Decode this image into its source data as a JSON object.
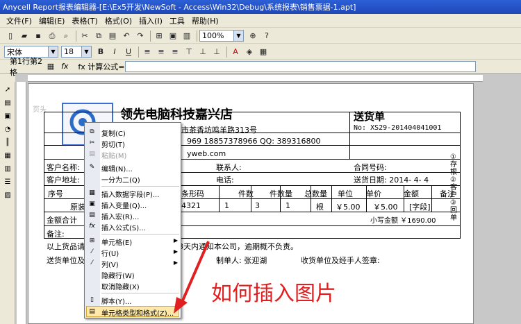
{
  "window": {
    "title": "Anycell Report报表编辑器-[E:\\Ex5开发\\NewSoft - Access\\Win32\\Debug\\系统报表\\销售票据-1.apt]"
  },
  "menu": [
    "文件(F)",
    "编辑(E)",
    "表格(T)",
    "格式(O)",
    "插入(I)",
    "工具",
    "帮助(H)"
  ],
  "toolbar": {
    "zoom": "100%"
  },
  "format": {
    "font": "宋体",
    "size": "18"
  },
  "formula": {
    "cell_ref": "第1行第2格",
    "fx_label": "fx",
    "calc_label": "fx 计算公式="
  },
  "report": {
    "watermark": "页头",
    "company": "领先电脑科技嘉兴店",
    "doc_title": "送货单",
    "address": "地址：浙江省嘉兴市茶香坊鸣羊路313号",
    "doc_no": "No: XS29-201404041001",
    "phone": "969 18857378966 QQ: 389316800",
    "web": "yweb.com",
    "customer_name_label": "客户名称:",
    "contact_label": "联系人:",
    "contract_label": "合同号码:",
    "customer_addr_label": "客户地址:",
    "tel_label": "电话:",
    "ship_date_label": "送货日期: 2014- 4- 4",
    "headers": [
      "序号",
      "条形码",
      "件数",
      "件数量",
      "总数量",
      "单位",
      "单价",
      "金额",
      "备注"
    ],
    "row": {
      "barcode": "4321",
      "qty": "1",
      "qty2": "3",
      "total": "1",
      "unit": "根",
      "price": "￥5.00",
      "amount": "￥5.00",
      "note": "[字段]"
    },
    "row_partial": "原装",
    "total_label": "金额合计",
    "big_total": "小写金额 ￥1690.00",
    "remark_label": "备注:",
    "footer_note": "以上货品请核",
    "footer_note2": "3天内通知本公司，逾期概不负责。",
    "sender_label": "送货单位及经",
    "handler": "制单人: 张迎湖",
    "receiver_label": "收货单位及经手人签章:",
    "side_text": "①存根 ②客户 ③回单"
  },
  "context_menu": [
    "复制(C)",
    "剪切(T)",
    "粘贴(M)",
    "编辑(N)...",
    "一分为二(Q)",
    "插入数据字段(P)...",
    "插入变量(Q)...",
    "插入宏(R)...",
    "插入公式(S)...",
    "单元格(E)",
    "行(U)",
    "列(V)",
    "隐藏行(W)",
    "取消隐藏(X)",
    "脚本(Y)...",
    "单元格类型和格式(Z)..."
  ],
  "annotation": "如何插入图片",
  "colors": {
    "title_bar": "#1e47b8",
    "annotation": "#e02020",
    "highlight": "#ffe8a8"
  }
}
